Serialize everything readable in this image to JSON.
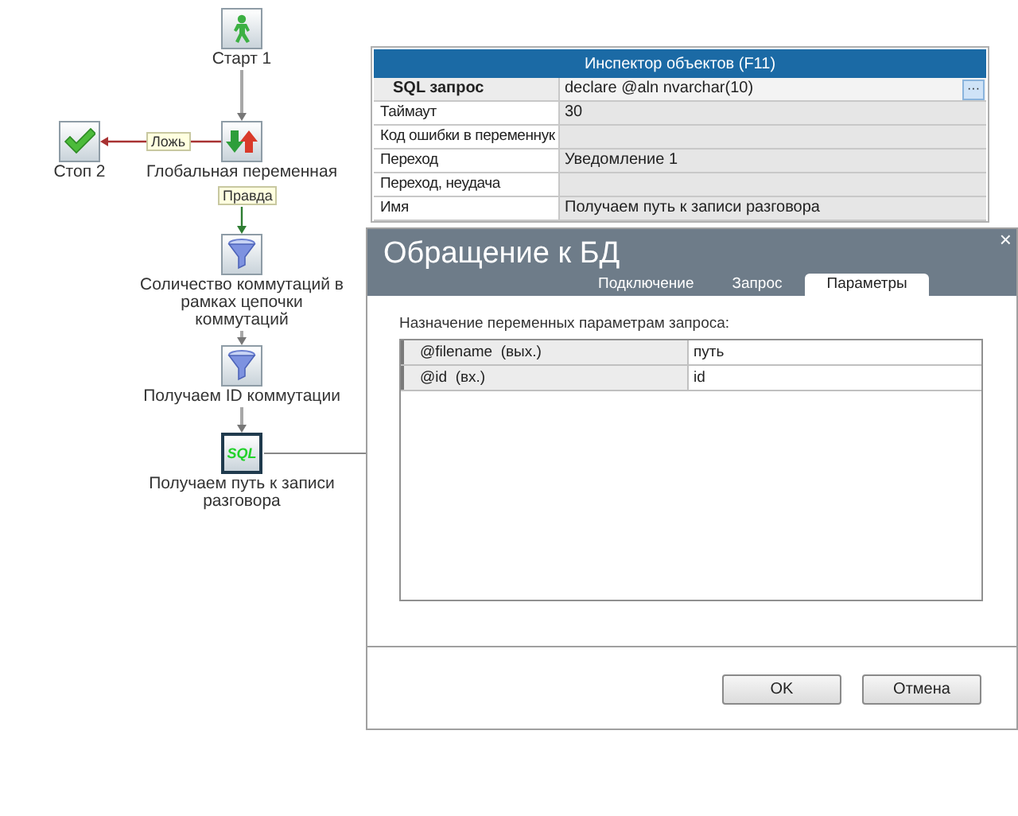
{
  "flow": {
    "nodes": [
      {
        "kind": "start",
        "label": "Старт 1",
        "selected": false
      },
      {
        "kind": "stop",
        "label": "Стоп 2",
        "selected": false
      },
      {
        "kind": "variable",
        "label": "Глобальная переменная",
        "selected": false
      },
      {
        "kind": "filter",
        "label": "Соличество коммутаций в рамках цепочки коммутаций",
        "selected": false
      },
      {
        "kind": "filter",
        "label": "Получаем ID коммутации",
        "selected": false
      },
      {
        "kind": "sql",
        "label": "Получаем путь к записи разговора",
        "icon_text": "SQL",
        "selected": true
      }
    ],
    "edges": [
      {
        "kind": "plain"
      },
      {
        "kind": "false",
        "label": "Ложь"
      },
      {
        "kind": "true",
        "label": "Правда"
      },
      {
        "kind": "plain"
      },
      {
        "kind": "plain"
      }
    ]
  },
  "inspector": {
    "title": "Инспектор объектов (F11)",
    "rows": [
      {
        "name": "SQL запрос",
        "value": "declare @aln nvarchar(10)",
        "selected": true
      },
      {
        "name": "Таймаут",
        "value": "30",
        "selected": false
      },
      {
        "name": "Код ошибки в переменнук",
        "value": "",
        "selected": false
      },
      {
        "name": "Переход",
        "value": "Уведомление 1",
        "selected": false
      },
      {
        "name": "Переход, неудача",
        "value": "",
        "selected": false
      },
      {
        "name": "Имя",
        "value": "Получаем путь к записи разговора",
        "selected": false
      }
    ],
    "ellipsis": "···"
  },
  "dialog": {
    "title": "Обращение к БД",
    "close": "×",
    "tabs": [
      {
        "label": "Подключение",
        "selected": false
      },
      {
        "label": "Запрос",
        "selected": false
      },
      {
        "label": "Параметры",
        "selected": true
      }
    ],
    "caption": "Назначение переменных параметрам запроса:",
    "params": [
      {
        "name": "@filename  (вых.)",
        "value": "путь"
      },
      {
        "name": "@id  (вх.)",
        "value": "id"
      }
    ],
    "buttons": [
      "OK",
      "Отмена"
    ]
  }
}
